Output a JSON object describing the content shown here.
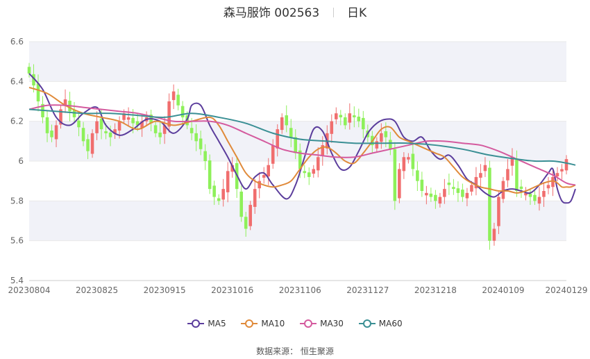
{
  "title": "森马服饰 002563",
  "subtitle": "日K",
  "source_label": "数据来源：",
  "source_name": "恒生聚源",
  "colors": {
    "up": "#f06e6e",
    "down": "#8ef05a",
    "ma5": "#5b3d9c",
    "ma10": "#e08a3a",
    "ma30": "#d45a9e",
    "ma60": "#3a8f94",
    "grid": "#e8e8e8",
    "band": "#f1f2f8"
  },
  "chart_data": {
    "type": "candlestick",
    "ylim": [
      5.4,
      6.6
    ],
    "yticks": [
      "5.4",
      "5.6",
      "5.8",
      "6",
      "6.2",
      "6.4",
      "6.6"
    ],
    "xticks": [
      {
        "label": "20230804",
        "index": 0
      },
      {
        "label": "20230825",
        "index": 15
      },
      {
        "label": "20230915",
        "index": 30
      },
      {
        "label": "20231016",
        "index": 45
      },
      {
        "label": "20231106",
        "index": 60
      },
      {
        "label": "20231127",
        "index": 75
      },
      {
        "label": "20231218",
        "index": 90
      },
      {
        "label": "20240109",
        "index": 105
      },
      {
        "label": "20240129",
        "index": 119
      }
    ],
    "closes": [
      6.44,
      6.38,
      6.3,
      6.22,
      6.14,
      6.12,
      6.18,
      6.26,
      6.31,
      6.25,
      6.22,
      6.17,
      6.1,
      6.05,
      6.14,
      6.2,
      6.16,
      6.14,
      6.12,
      6.16,
      6.2,
      6.24,
      6.22,
      6.19,
      6.18,
      6.2,
      6.22,
      6.19,
      6.14,
      6.12,
      6.18,
      6.3,
      6.35,
      6.28,
      6.22,
      6.18,
      6.14,
      6.1,
      6.06,
      6.0,
      5.86,
      5.82,
      5.8,
      5.86,
      5.95,
      5.98,
      5.86,
      5.72,
      5.66,
      5.78,
      5.86,
      5.9,
      5.93,
      5.98,
      6.08,
      6.16,
      6.22,
      6.18,
      6.12,
      6.04,
      5.96,
      5.94,
      5.92,
      5.96,
      6.02,
      6.08,
      6.14,
      6.2,
      6.24,
      6.22,
      6.18,
      6.24,
      6.22,
      6.2,
      6.16,
      6.12,
      6.08,
      6.1,
      6.14,
      6.12,
      6.06,
      5.8,
      5.96,
      6.02,
      6.02,
      5.96,
      5.9,
      5.85,
      5.84,
      5.82,
      5.8,
      5.82,
      5.86,
      5.88,
      5.86,
      5.84,
      5.82,
      5.84,
      5.88,
      5.92,
      5.94,
      5.98,
      5.6,
      5.66,
      5.82,
      5.9,
      5.96,
      6.02,
      5.85,
      5.86,
      5.84,
      5.82,
      5.8,
      5.82,
      5.85,
      5.88,
      5.92,
      5.94,
      5.96,
      6.01
    ],
    "series": [
      {
        "name": "MA5",
        "key": "ma5",
        "points": [
          [
            0,
            6.44
          ],
          [
            3,
            6.36
          ],
          [
            6,
            6.22
          ],
          [
            9,
            6.18
          ],
          [
            12,
            6.24
          ],
          [
            15,
            6.27
          ],
          [
            17,
            6.18
          ],
          [
            20,
            6.13
          ],
          [
            23,
            6.16
          ],
          [
            26,
            6.21
          ],
          [
            29,
            6.2
          ],
          [
            32,
            6.14
          ],
          [
            35,
            6.21
          ],
          [
            36,
            6.28
          ],
          [
            38,
            6.28
          ],
          [
            40,
            6.18
          ],
          [
            42,
            6.1
          ],
          [
            44,
            6.02
          ],
          [
            46,
            5.93
          ],
          [
            48,
            5.86
          ],
          [
            50,
            5.92
          ],
          [
            52,
            5.94
          ],
          [
            54,
            5.88
          ],
          [
            57,
            5.81
          ],
          [
            59,
            5.88
          ],
          [
            61,
            6.02
          ],
          [
            63,
            6.16
          ],
          [
            65,
            6.15
          ],
          [
            67,
            6.04
          ],
          [
            69,
            5.96
          ],
          [
            71,
            5.97
          ],
          [
            73,
            6.05
          ],
          [
            75,
            6.14
          ],
          [
            77,
            6.19
          ],
          [
            79,
            6.21
          ],
          [
            81,
            6.2
          ],
          [
            83,
            6.12
          ],
          [
            85,
            6.1
          ],
          [
            87,
            6.12
          ],
          [
            89,
            6.05
          ],
          [
            91,
            6.01
          ],
          [
            93,
            6.03
          ],
          [
            95,
            5.98
          ],
          [
            97,
            5.91
          ],
          [
            99,
            5.88
          ],
          [
            101,
            5.84
          ],
          [
            103,
            5.82
          ],
          [
            105,
            5.85
          ],
          [
            107,
            5.86
          ],
          [
            109,
            5.85
          ],
          [
            111,
            5.84
          ],
          [
            113,
            5.88
          ],
          [
            115,
            5.94
          ],
          [
            116,
            5.96
          ],
          [
            117,
            5.86
          ],
          [
            118,
            5.8
          ],
          [
            119,
            5.79
          ],
          [
            120,
            5.8
          ],
          [
            121,
            5.86
          ]
        ]
      },
      {
        "name": "MA10",
        "key": "ma10",
        "points": [
          [
            0,
            6.37
          ],
          [
            4,
            6.34
          ],
          [
            8,
            6.28
          ],
          [
            12,
            6.24
          ],
          [
            16,
            6.22
          ],
          [
            20,
            6.2
          ],
          [
            24,
            6.16
          ],
          [
            28,
            6.2
          ],
          [
            32,
            6.18
          ],
          [
            36,
            6.2
          ],
          [
            40,
            6.22
          ],
          [
            42,
            6.18
          ],
          [
            44,
            6.1
          ],
          [
            46,
            6.02
          ],
          [
            48,
            5.94
          ],
          [
            50,
            5.9
          ],
          [
            52,
            5.88
          ],
          [
            54,
            5.87
          ],
          [
            56,
            5.88
          ],
          [
            58,
            5.9
          ],
          [
            60,
            5.96
          ],
          [
            62,
            6.02
          ],
          [
            64,
            6.06
          ],
          [
            66,
            6.07
          ],
          [
            68,
            6.04
          ],
          [
            70,
            6.0
          ],
          [
            72,
            5.99
          ],
          [
            74,
            6.04
          ],
          [
            76,
            6.1
          ],
          [
            78,
            6.16
          ],
          [
            80,
            6.17
          ],
          [
            82,
            6.12
          ],
          [
            84,
            6.1
          ],
          [
            86,
            6.08
          ],
          [
            88,
            6.06
          ],
          [
            90,
            6.04
          ],
          [
            92,
            6.02
          ],
          [
            94,
            5.97
          ],
          [
            96,
            5.92
          ],
          [
            98,
            5.89
          ],
          [
            100,
            5.87
          ],
          [
            102,
            5.86
          ],
          [
            104,
            5.85
          ],
          [
            106,
            5.85
          ],
          [
            108,
            5.84
          ],
          [
            110,
            5.85
          ],
          [
            112,
            5.87
          ],
          [
            114,
            5.89
          ],
          [
            116,
            5.9
          ],
          [
            117,
            5.89
          ],
          [
            118,
            5.87
          ],
          [
            119,
            5.87
          ],
          [
            120,
            5.87
          ],
          [
            121,
            5.88
          ]
        ]
      },
      {
        "name": "MA30",
        "key": "ma30",
        "points": [
          [
            0,
            6.26
          ],
          [
            4,
            6.28
          ],
          [
            8,
            6.28
          ],
          [
            12,
            6.27
          ],
          [
            16,
            6.26
          ],
          [
            20,
            6.25
          ],
          [
            24,
            6.24
          ],
          [
            28,
            6.22
          ],
          [
            32,
            6.2
          ],
          [
            36,
            6.2
          ],
          [
            40,
            6.2
          ],
          [
            44,
            6.18
          ],
          [
            48,
            6.14
          ],
          [
            52,
            6.1
          ],
          [
            56,
            6.06
          ],
          [
            60,
            6.04
          ],
          [
            64,
            6.03
          ],
          [
            68,
            6.02
          ],
          [
            72,
            6.02
          ],
          [
            76,
            6.04
          ],
          [
            80,
            6.06
          ],
          [
            84,
            6.08
          ],
          [
            88,
            6.1
          ],
          [
            92,
            6.1
          ],
          [
            96,
            6.09
          ],
          [
            100,
            6.08
          ],
          [
            104,
            6.05
          ],
          [
            108,
            6.01
          ],
          [
            112,
            5.97
          ],
          [
            116,
            5.93
          ],
          [
            119,
            5.89
          ],
          [
            121,
            5.88
          ]
        ]
      },
      {
        "name": "MA60",
        "key": "ma60",
        "points": [
          [
            0,
            6.26
          ],
          [
            6,
            6.25
          ],
          [
            12,
            6.24
          ],
          [
            18,
            6.24
          ],
          [
            24,
            6.23
          ],
          [
            30,
            6.22
          ],
          [
            36,
            6.24
          ],
          [
            42,
            6.22
          ],
          [
            48,
            6.19
          ],
          [
            54,
            6.14
          ],
          [
            60,
            6.11
          ],
          [
            66,
            6.1
          ],
          [
            72,
            6.09
          ],
          [
            78,
            6.09
          ],
          [
            84,
            6.09
          ],
          [
            90,
            6.08
          ],
          [
            96,
            6.06
          ],
          [
            102,
            6.03
          ],
          [
            108,
            6.01
          ],
          [
            112,
            6.0
          ],
          [
            116,
            6.0
          ],
          [
            119,
            5.99
          ],
          [
            121,
            5.98
          ]
        ]
      }
    ]
  }
}
